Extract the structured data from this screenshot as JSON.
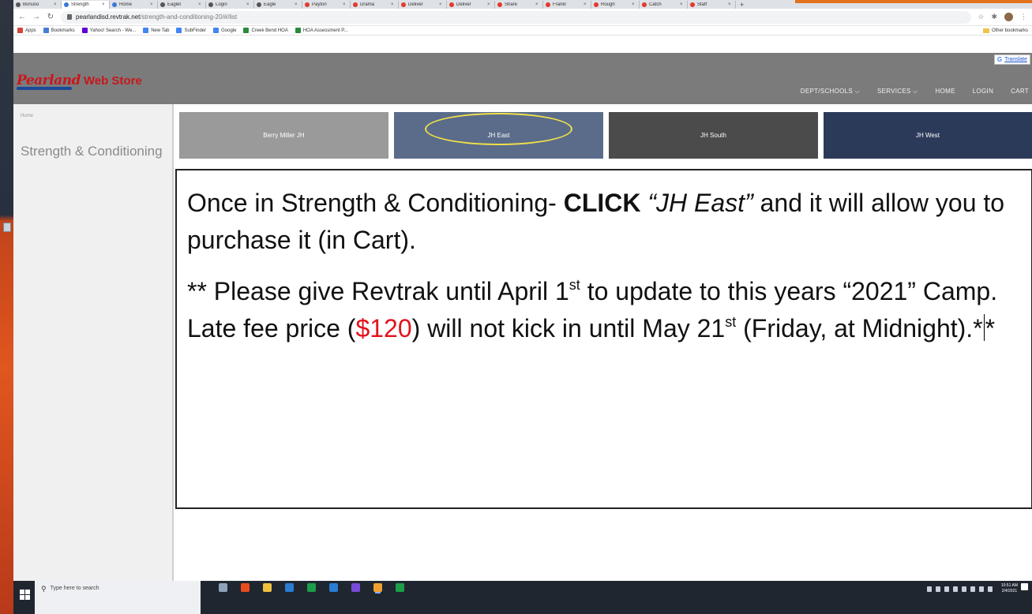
{
  "browser": {
    "tabs": [
      "Bonuso",
      "Strength",
      "Home",
      "Eaglet",
      "Login",
      "Eagle",
      "Payton",
      "Drama",
      "Deliver",
      "Deliver",
      "Share",
      "Frankl",
      "Rough",
      "Catch",
      "Staff"
    ],
    "new_tab": "+",
    "url_host": "pearlandisd.revtrak.net",
    "url_path": "/strength-and-conditioning-20/#/list",
    "bookmarks": [
      "Apps",
      "Bookmarks",
      "Yahoo! Search - We...",
      "New Tab",
      "SubFinder",
      "Google",
      "Creek Bend HOA",
      "HOA Assessment P..."
    ],
    "other_bookmarks": "Other bookmarks"
  },
  "site": {
    "logo": "Pearland",
    "logo_sub": "Web Store",
    "translate_g": "G",
    "translate_label": "Translate",
    "nav": [
      "DEPT/SCHOOLS ⌵",
      "SERVICES ⌵",
      "HOME",
      "LOGIN",
      "CART"
    ]
  },
  "sidebar": {
    "breadcrumb": "Home",
    "title": "Strength & Conditioning"
  },
  "tiles": [
    "Berry Miller JH",
    "JH East",
    "JH South",
    "JH West"
  ],
  "callout": {
    "p1_a": "Once in Strength & Conditioning- ",
    "p1_bold": "CLICK",
    "p1_b": " ",
    "p1_italic": "“JH East”",
    "p1_c": " and it will allow you to purchase it (in Cart).",
    "p2_a": "** Please give Revtrak until April 1",
    "p2_sup1": "st",
    "p2_b": " to update to this years “2021” Camp. Late fee price (",
    "p2_red": "$120",
    "p2_c": ") will not kick in until May 21",
    "p2_sup2": "st",
    "p2_d": " (Friday, at Midnight).*",
    "p2_e": "*",
    "accent_red": "#e3121b"
  },
  "taskbar": {
    "search_placeholder": "Type here to search",
    "time": "10:51 AM",
    "date": "2/4/2021",
    "app_colors": [
      "#8fa3b8",
      "#e84c1f",
      "#f0c040",
      "#2b7cd3",
      "#1e9e4a",
      "#2b7cd3",
      "#7a4bd8",
      "#f0a030",
      "#1e9e4a"
    ]
  }
}
